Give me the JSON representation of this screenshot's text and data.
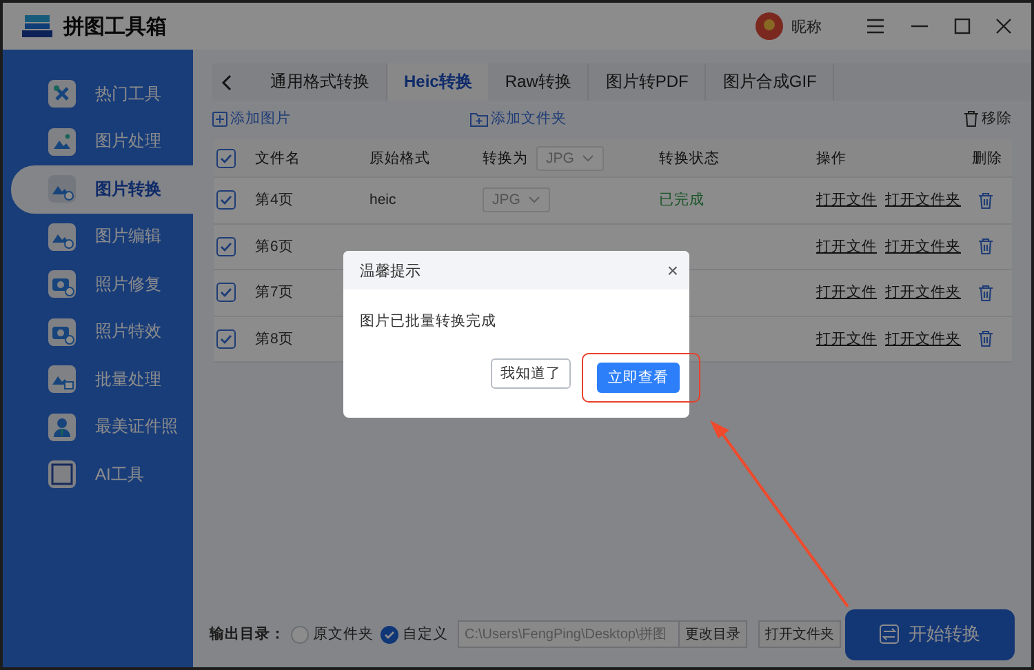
{
  "window": {
    "title": "拼图工具箱"
  },
  "user": {
    "name": "昵称"
  },
  "sidebar": {
    "items": [
      {
        "label": "热门工具",
        "selected": false
      },
      {
        "label": "图片处理",
        "selected": false
      },
      {
        "label": "图片转换",
        "selected": true
      },
      {
        "label": "图片编辑",
        "selected": false
      },
      {
        "label": "照片修复",
        "selected": false
      },
      {
        "label": "照片特效",
        "selected": false
      },
      {
        "label": "批量处理",
        "selected": false
      },
      {
        "label": "最美证件照",
        "selected": false
      },
      {
        "label": "AI工具",
        "selected": false
      }
    ]
  },
  "tabs": [
    {
      "label": "通用格式转换",
      "selected": false
    },
    {
      "label": "Heic转换",
      "selected": true
    },
    {
      "label": "Raw转换",
      "selected": false
    },
    {
      "label": "图片转PDF",
      "selected": false
    },
    {
      "label": "图片合成GIF",
      "selected": false
    }
  ],
  "toolbar": {
    "add_image": "添加图片",
    "add_folder": "添加文件夹",
    "remove": "移除"
  },
  "table": {
    "select_all": {
      "checked": true
    },
    "columns": [
      "文件名",
      "原始格式",
      "转换为",
      "转换状态",
      "操作",
      "删除"
    ],
    "target_format": "JPG",
    "rows": [
      {
        "checked": true,
        "name": "第4页",
        "format": "heic",
        "target": "JPG",
        "status": "已完成",
        "actions": [
          "打开文件",
          "打开文件夹"
        ]
      },
      {
        "checked": true,
        "name": "第6页",
        "actions": [
          "打开文件",
          "打开文件夹"
        ]
      },
      {
        "checked": true,
        "name": "第7页",
        "actions": [
          "打开文件",
          "打开文件夹"
        ]
      },
      {
        "checked": true,
        "name": "第8页",
        "actions": [
          "打开文件",
          "打开文件夹"
        ]
      }
    ]
  },
  "output": {
    "label": "输出目录：",
    "options": [
      {
        "label": "原文件夹",
        "selected": false
      },
      {
        "label": "自定义",
        "selected": true
      }
    ],
    "path": "C:\\Users\\FengPing\\Desktop\\拼图",
    "change": "更改目录",
    "open": "打开文件夹",
    "start": "开始转换"
  },
  "dialog": {
    "title": "温馨提示",
    "close": "×",
    "message": "图片已批量转换完成",
    "buttons": [
      {
        "label": "我知道了",
        "kind": "secondary"
      },
      {
        "label": "立即查看",
        "kind": "primary"
      }
    ]
  }
}
